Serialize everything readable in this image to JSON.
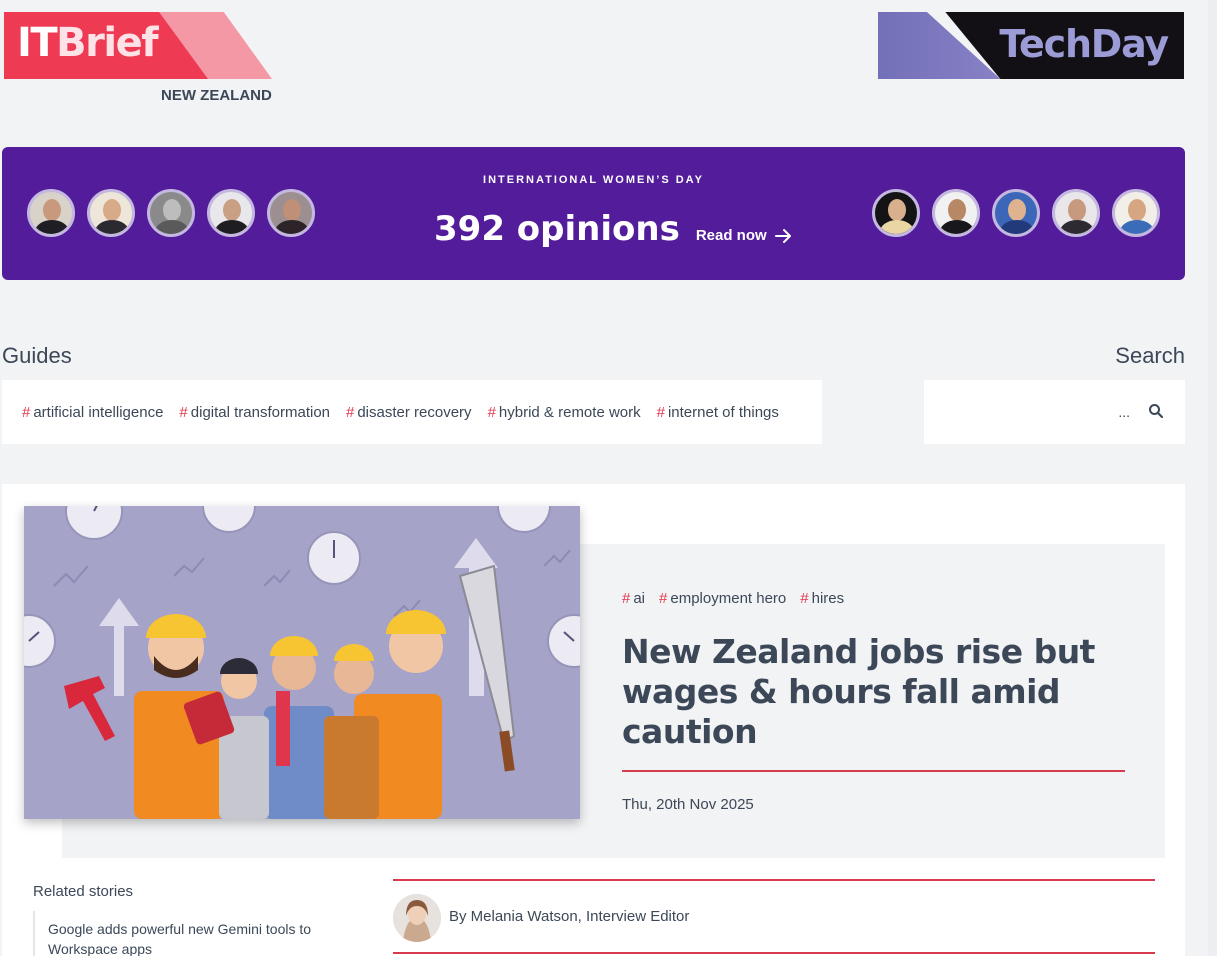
{
  "brand": {
    "primary_logo": "ITBrief",
    "primary_logo_parts": [
      "IT",
      "Brief"
    ],
    "region": "NEW ZEALAND",
    "secondary_logo": "TechDay",
    "accent_color": "#ee3a52"
  },
  "banner": {
    "eyebrow": "INTERNATIONAL WOMEN’S DAY",
    "count": "392 opinions",
    "cta": "Read now",
    "cta_icon": "arrow-right-icon",
    "background": "#531c9a"
  },
  "guides": {
    "title": "Guides",
    "tags": [
      "artificial intelligence",
      "digital transformation",
      "disaster recovery",
      "hybrid & remote work",
      "internet of things"
    ]
  },
  "search": {
    "title": "Search",
    "placeholder": "...",
    "icon": "search-icon"
  },
  "article": {
    "tags": [
      "ai",
      "employment hero",
      "hires"
    ],
    "title": "New Zealand jobs rise but wages & hours fall amid caution",
    "date": "Thu, 20th Nov 2025",
    "byline": "By Melania Watson, Interview Editor"
  },
  "related": {
    "title": "Related stories",
    "items": [
      "Google adds powerful new Gemini tools to Workspace apps"
    ]
  }
}
